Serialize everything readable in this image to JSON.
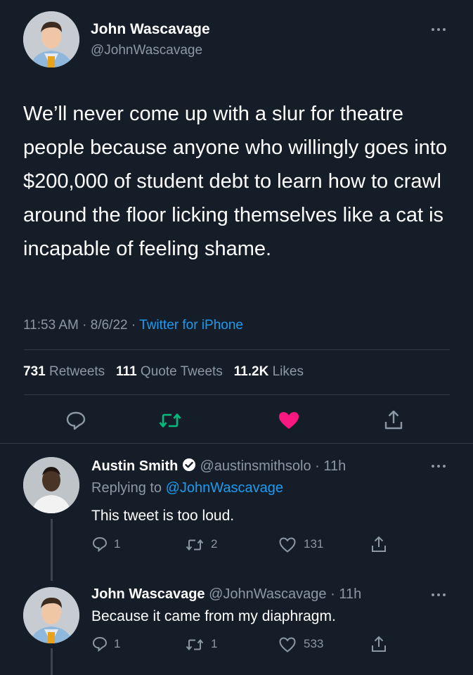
{
  "main_tweet": {
    "author_name": "John Wascavage",
    "author_handle": "@JohnWascavage",
    "text": "We’ll never come up with a slur for theatre people because anyone who willingly goes into $200,000 of student debt to learn how to crawl around the floor licking themselves like a cat is incapable of feeling shame.",
    "time": "11:53 AM",
    "date": "8/6/22",
    "source": "Twitter for iPhone",
    "retweets_count": "731",
    "retweets_label": "Retweets",
    "quote_count": "111",
    "quote_label": "Quote Tweets",
    "likes_count": "11.2K",
    "likes_label": "Likes",
    "actions": [
      "reply-icon",
      "retweet-icon",
      "like-icon",
      "share-icon"
    ],
    "like_color": "#f91880",
    "retweet_color": "#00ba7c"
  },
  "replies": [
    {
      "author_name": "Austin Smith",
      "verified": true,
      "author_handle": "@austinsmithsolo",
      "time": "11h",
      "replying_to_label": "Replying to",
      "replying_to_handle": "@JohnWascavage",
      "text": "This tweet is too loud.",
      "reply_count": "1",
      "retweet_count": "2",
      "like_count": "131"
    },
    {
      "author_name": "John Wascavage",
      "author_handle": "@JohnWascavage",
      "time": "11h",
      "text": "Because it came from my diaphragm.",
      "reply_count": "1",
      "retweet_count": "1",
      "like_count": "533"
    }
  ],
  "colors": {
    "background": "#151d28",
    "muted": "#8b98a5",
    "link": "#1d9bf0"
  }
}
